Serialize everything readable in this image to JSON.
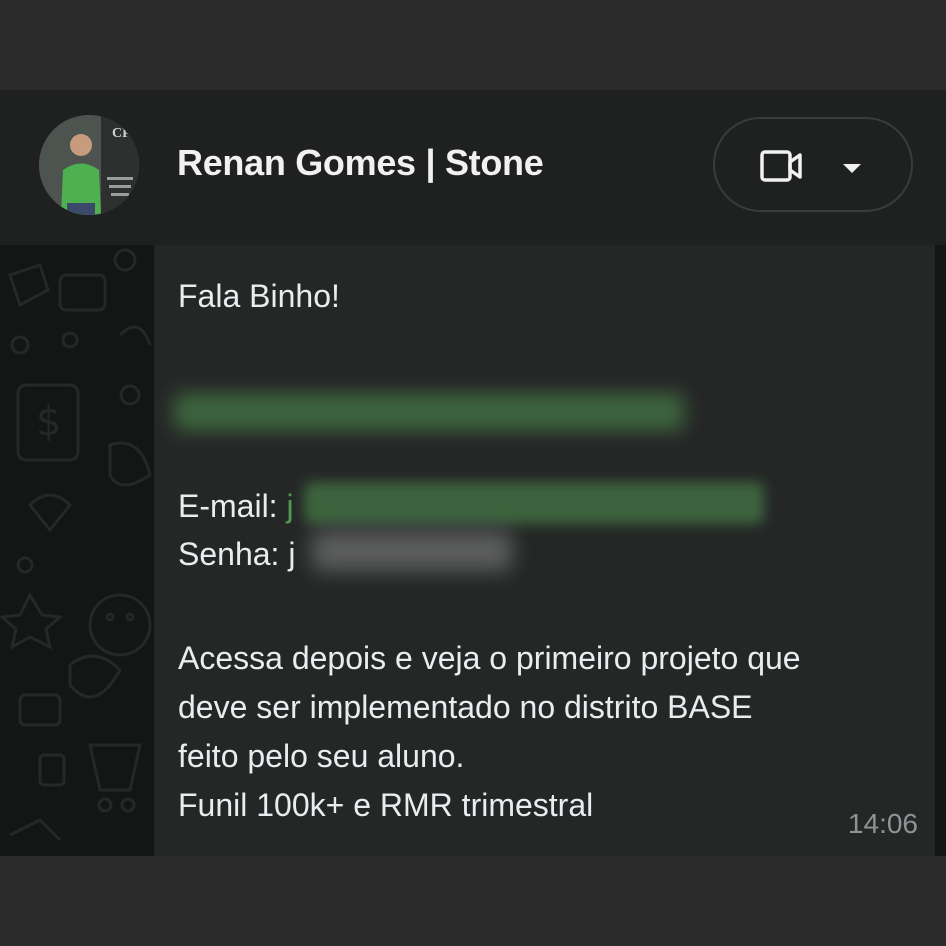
{
  "header": {
    "contact_name": "Renan Gomes | Stone",
    "call_button_icon": "video-camera-icon",
    "dropdown_icon": "caret-down-icon"
  },
  "message": {
    "greeting": "Fala Binho!",
    "email_label": "E-mail:",
    "email_visible": "j",
    "password_label": "Senha:",
    "password_visible": "j",
    "body_lines": [
      "Acessa depois e veja o primeiro projeto que",
      "deve ser implementado no distrito BASE",
      "feito pelo seu aluno.",
      "Funil 100k+ e RMR trimestral"
    ],
    "time": "14:06"
  },
  "colors": {
    "background": "#2b2b2b",
    "header": "#1f2020",
    "chat_background": "#141515",
    "bubble": "#252727",
    "text": "#e9edef",
    "timestamp": "#8f9395",
    "redaction_green": "#4f9a50"
  }
}
